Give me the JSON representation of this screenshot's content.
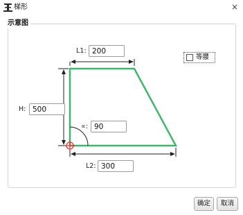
{
  "window": {
    "title": "梯形",
    "icon": "trapezoid-app-icon",
    "close_glyph": "×"
  },
  "group": {
    "legend": "示意图"
  },
  "fields": {
    "l1": {
      "label": "L1:",
      "value": "200"
    },
    "h": {
      "label": "H:",
      "value": "500"
    },
    "angle": {
      "label": "∝:",
      "value": "90"
    },
    "l2": {
      "label": "L2:",
      "value": "300"
    }
  },
  "checkbox": {
    "label": "等腰",
    "checked": false
  },
  "buttons": {
    "ok": "确定",
    "cancel": "取消"
  },
  "colors": {
    "shape_stroke": "#3cb86a",
    "origin_marker": "#e53935"
  }
}
